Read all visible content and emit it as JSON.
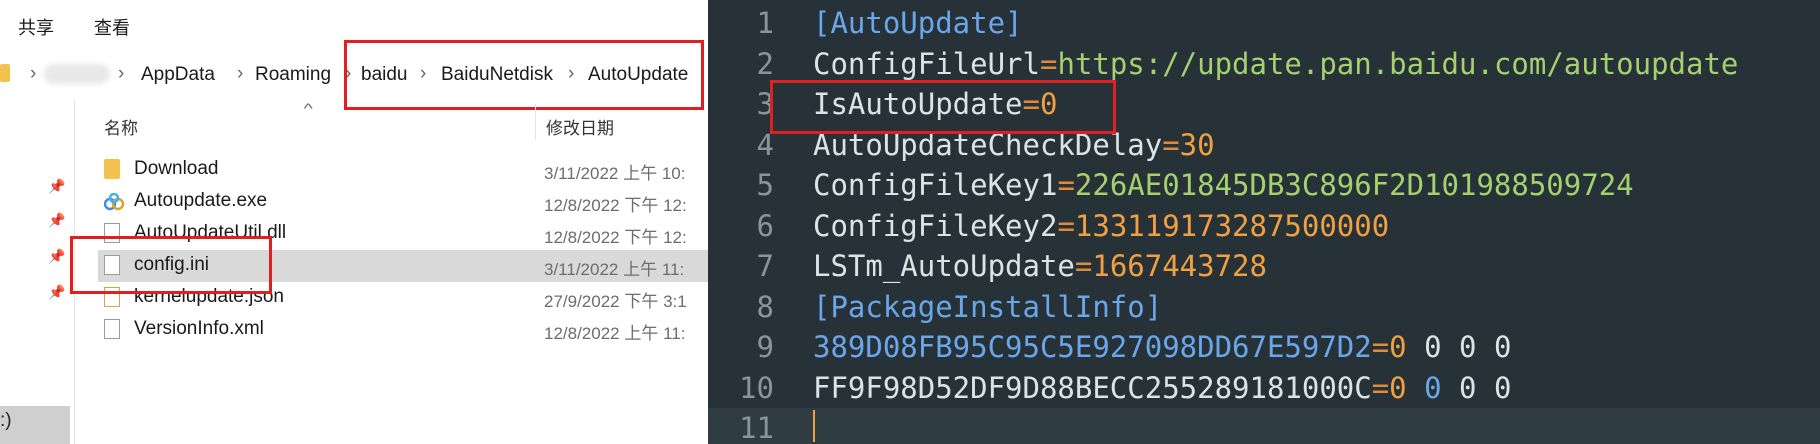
{
  "ribbon": {
    "tabs": [
      "共享",
      "查看"
    ]
  },
  "address_bar": {
    "segments": [
      "AppData",
      "Roaming",
      "baidu",
      "BaiduNetdisk",
      "AutoUpdate"
    ]
  },
  "columns": {
    "name": "名称",
    "date": "修改日期"
  },
  "files": [
    {
      "name": "Download",
      "date": "3/11/2022 上午 10:",
      "icon": "folder-icon"
    },
    {
      "name": "Autoupdate.exe",
      "date": "12/8/2022 下午 12:",
      "icon": "exe-icon"
    },
    {
      "name": "AutoUpdateUtil.dll",
      "date": "12/8/2022 下午 12:",
      "icon": "dll-icon"
    },
    {
      "name": "config.ini",
      "date": "3/11/2022 上午 11:",
      "icon": "ini-icon",
      "selected": true
    },
    {
      "name": "kernelupdate.json",
      "date": "27/9/2022 下午 3:1",
      "icon": "json-icon"
    },
    {
      "name": "VersionInfo.xml",
      "date": "12/8/2022 上午 11:",
      "icon": "xml-icon"
    }
  ],
  "nav_pane": {
    "drive_label": ":)"
  },
  "editor": {
    "lines": [
      {
        "num": "1",
        "parts": [
          {
            "t": "[AutoUpdate]",
            "c": "k-sect"
          }
        ]
      },
      {
        "num": "2",
        "parts": [
          {
            "t": "ConfigFileUrl",
            "c": "k-key"
          },
          {
            "t": "=",
            "c": "k-eq"
          },
          {
            "t": "https://update.pan.baidu.com/autoupdate",
            "c": "k-url"
          }
        ]
      },
      {
        "num": "3",
        "parts": [
          {
            "t": "IsAutoUpdate",
            "c": "k-key"
          },
          {
            "t": "=",
            "c": "k-eq"
          },
          {
            "t": "0",
            "c": "k-num"
          }
        ]
      },
      {
        "num": "4",
        "parts": [
          {
            "t": "AutoUpdateCheckDelay",
            "c": "k-key"
          },
          {
            "t": "=",
            "c": "k-eq"
          },
          {
            "t": "30",
            "c": "k-num"
          }
        ]
      },
      {
        "num": "5",
        "parts": [
          {
            "t": "ConfigFileKey1",
            "c": "k-key"
          },
          {
            "t": "=",
            "c": "k-eq"
          },
          {
            "t": "226AE01845DB3C896F2D101988509724",
            "c": "k-hex"
          }
        ]
      },
      {
        "num": "6",
        "parts": [
          {
            "t": "ConfigFileKey2",
            "c": "k-key"
          },
          {
            "t": "=",
            "c": "k-eq"
          },
          {
            "t": "133119173287500000",
            "c": "k-num"
          }
        ]
      },
      {
        "num": "7",
        "parts": [
          {
            "t": "LSTm_AutoUpdate",
            "c": "k-key"
          },
          {
            "t": "=",
            "c": "k-eq"
          },
          {
            "t": "1667443728",
            "c": "k-num"
          }
        ]
      },
      {
        "num": "8",
        "parts": [
          {
            "t": "[PackageInstallInfo]",
            "c": "k-sect"
          }
        ]
      },
      {
        "num": "9",
        "parts": [
          {
            "t": "389D08FB95C95C5E927098DD67E597D2",
            "c": "k-blue"
          },
          {
            "t": "=",
            "c": "k-eq"
          },
          {
            "t": "0",
            "c": "k-num"
          },
          {
            "t": " 0 0 0",
            "c": "k-white"
          }
        ]
      },
      {
        "num": "10",
        "parts": [
          {
            "t": "FF9F98D52DF9D88BECC255289181000C",
            "c": "k-white"
          },
          {
            "t": "=",
            "c": "k-eq"
          },
          {
            "t": "0",
            "c": "k-num"
          },
          {
            "t": " ",
            "c": "k-white"
          },
          {
            "t": "0",
            "c": "k-blue"
          },
          {
            "t": " 0 0",
            "c": "k-white"
          }
        ]
      },
      {
        "num": "11",
        "parts": []
      }
    ]
  },
  "colors": {
    "highlight": "#e02020",
    "editor_bg": "#263238",
    "selection": "#d9d9d9"
  }
}
